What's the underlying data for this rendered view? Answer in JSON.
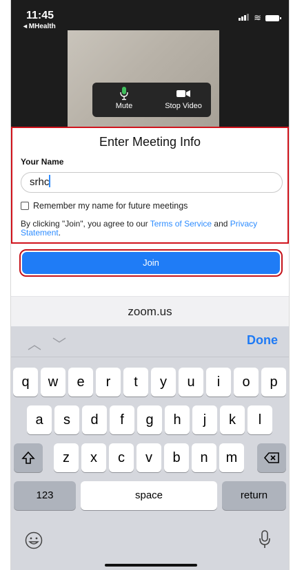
{
  "status_bar": {
    "time": "11:45",
    "back_app": "◂ MHealth"
  },
  "video_controls": {
    "mute_label": "Mute",
    "stop_video_label": "Stop Video"
  },
  "meeting_info": {
    "title": "Enter Meeting Info",
    "name_label": "Your Name",
    "name_value": "srhc",
    "remember_label": "Remember my name for future meetings",
    "terms_prefix": "By clicking \"Join\", you agree to our ",
    "terms_link": "Terms of Service",
    "terms_and": " and ",
    "privacy_link": "Privacy Statement",
    "terms_suffix": "."
  },
  "join_button": {
    "label": "Join"
  },
  "browser": {
    "url": "zoom.us"
  },
  "keyboard": {
    "done_label": "Done",
    "row1": [
      "q",
      "w",
      "e",
      "r",
      "t",
      "y",
      "u",
      "i",
      "o",
      "p"
    ],
    "row2": [
      "a",
      "s",
      "d",
      "f",
      "g",
      "h",
      "j",
      "k",
      "l"
    ],
    "row3": [
      "z",
      "x",
      "c",
      "v",
      "b",
      "n",
      "m"
    ],
    "numbers_label": "123",
    "space_label": "space",
    "return_label": "return"
  },
  "colors": {
    "accent": "#1f7cf6",
    "highlight": "#d0121b",
    "keyboard_bg": "#d5d7dd"
  },
  "icons": {
    "mute": "microphone-icon",
    "video": "video-camera-icon",
    "shift": "shift-icon",
    "delete": "backspace-icon",
    "emoji": "emoji-icon",
    "dictation": "microphone-icon"
  }
}
